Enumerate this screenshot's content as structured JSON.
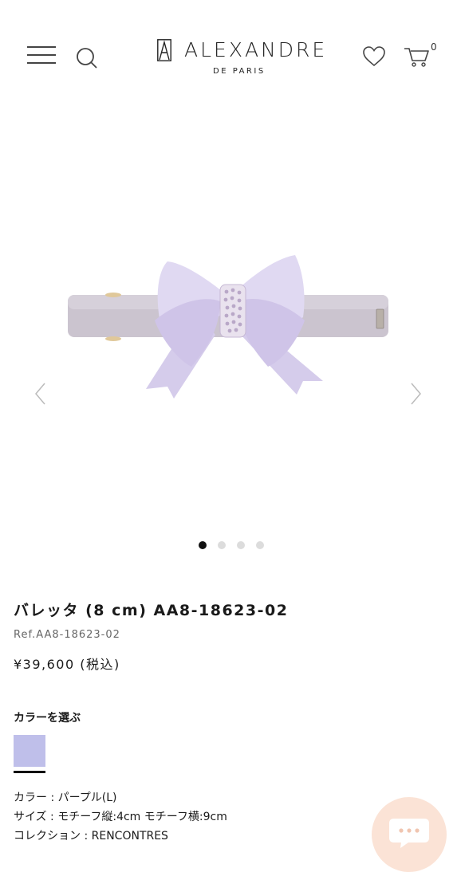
{
  "header": {
    "logo_text": "ALEXANDRE",
    "logo_sub": "DE PARIS",
    "cart_count": "0",
    "icons": {
      "menu": "hamburger-menu-icon",
      "search": "search-icon",
      "wishlist": "heart-icon",
      "cart": "cart-icon",
      "logo_mark": "alexandre-logo-mark"
    }
  },
  "gallery": {
    "image_count": 4,
    "active_index": 0,
    "product_colors": {
      "barrette": "#c8c0cc",
      "bow": "#ded6f0",
      "bow_shade": "#c7bde3",
      "crystal": "#e9e2ee"
    }
  },
  "product": {
    "title": "バレッタ (8 cm) AA8-18623-02",
    "ref": "Ref.AA8-18623-02",
    "price": "¥39,600 (税込)",
    "color_heading": "カラーを選ぶ",
    "swatch_color": "#bfbfea",
    "specs": [
      "カラー : パープル(L)",
      "サイズ : モチーフ縦:4cm モチーフ横:9cm",
      "コレクション : RENCONTRES"
    ]
  },
  "chat": {
    "icon": "chat-icon",
    "color": "#fbe3d6"
  }
}
